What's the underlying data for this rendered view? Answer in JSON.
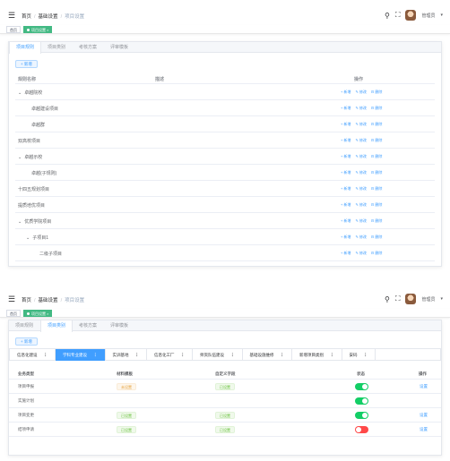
{
  "breadcrumb": [
    "首页",
    "基础设置",
    "项目设置"
  ],
  "user": {
    "name": "管理员"
  },
  "tags": {
    "home": "首页",
    "active": "项目设置"
  },
  "tabs": [
    "项目规则",
    "项目类别",
    "考核方案",
    "评审模板"
  ],
  "add_label": "+ 新增",
  "tree_table": {
    "headers": {
      "name": "规则名称",
      "desc": "描述",
      "ops": "操作"
    },
    "op_labels": {
      "add": "+ 新增",
      "edit": "✎ 修改",
      "del": "⊟ 删除"
    },
    "rows": [
      {
        "name": "卓越院校",
        "level": 0,
        "expand": true
      },
      {
        "name": "卓越建设项目",
        "level": 1,
        "expand": false
      },
      {
        "name": "卓越群",
        "level": 1,
        "expand": false
      },
      {
        "name": "双高校项目",
        "level": 0,
        "expand": false
      },
      {
        "name": "卓越示校",
        "level": 0,
        "expand": true
      },
      {
        "name": "卓越(子规则)",
        "level": 1,
        "expand": false
      },
      {
        "name": "十四五规划项目",
        "level": 0,
        "expand": false
      },
      {
        "name": "提质培优项目",
        "level": 0,
        "expand": false
      },
      {
        "name": "优质学院项目",
        "level": 0,
        "expand": true
      },
      {
        "name": "子项目1",
        "level": 1,
        "expand": true
      },
      {
        "name": "二级子项目",
        "level": 2,
        "expand": false
      }
    ]
  },
  "sub_tabs": [
    "信息化建设",
    "学科专业建设",
    "实训基地",
    "信息化工厂",
    "师资队伍建设",
    "基础设施维修",
    "新增项目类别",
    "安码"
  ],
  "active_sub_tab": 1,
  "cat_table": {
    "headers": [
      "业务类型",
      "材料模板",
      "自定义字段",
      "状态",
      "操作"
    ],
    "set_label": "设置",
    "rows": [
      {
        "type": "项目申报",
        "material": "未设置",
        "material_state": "warn",
        "custom": "已设置",
        "on": true
      },
      {
        "type": "实施计划",
        "material": "",
        "material_state": "",
        "custom": "",
        "on": true
      },
      {
        "type": "项目变更",
        "material": "已设置",
        "material_state": "ok",
        "custom": "已设置",
        "on": true
      },
      {
        "type": "结项申请",
        "material": "已设置",
        "material_state": "ok",
        "custom": "已设置",
        "on": false
      }
    ]
  },
  "colors": {
    "primary": "#409eff",
    "success": "#13ce66",
    "danger": "#ff4949",
    "tag_active": "#42b983"
  }
}
